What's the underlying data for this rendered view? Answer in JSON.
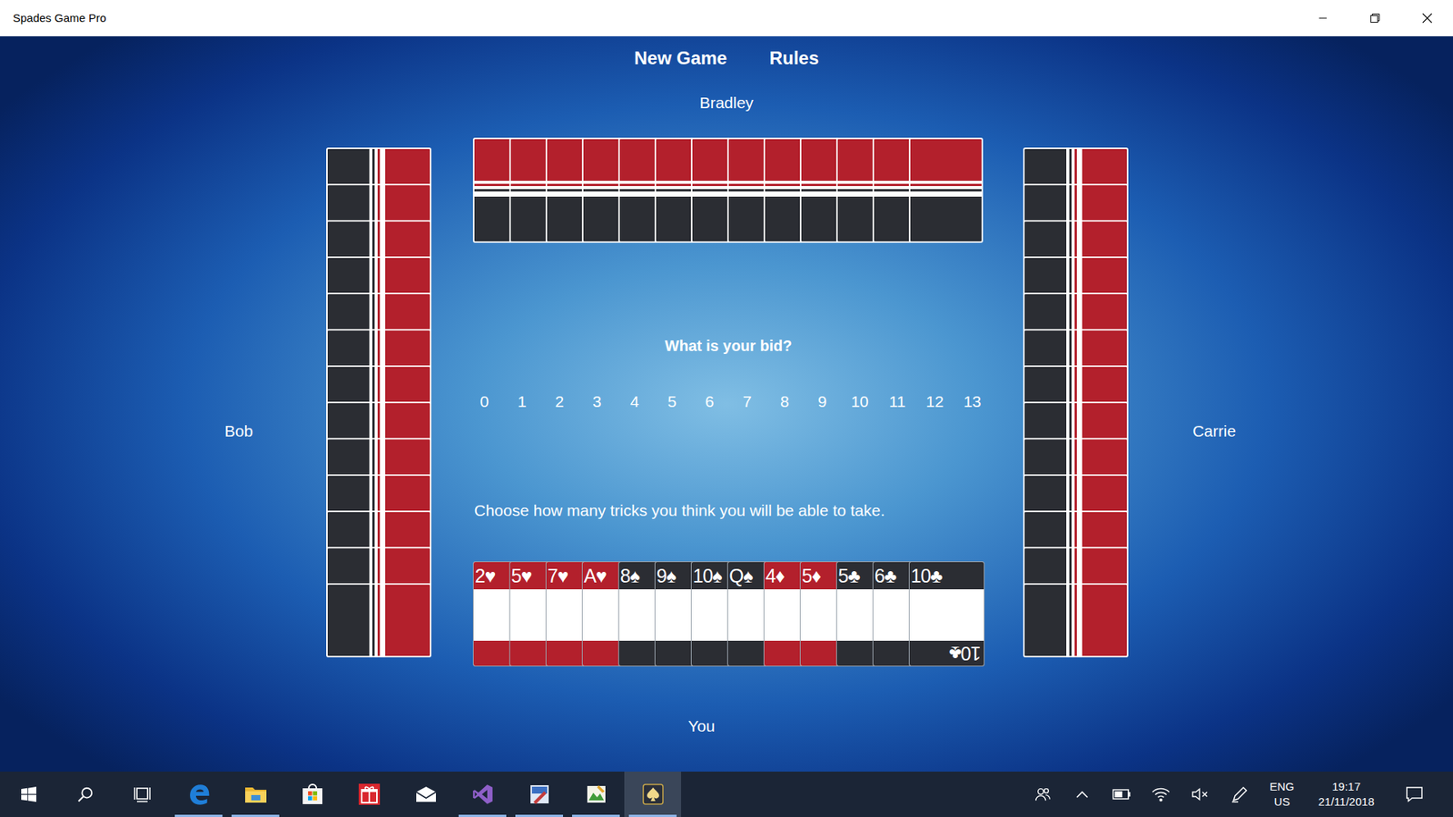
{
  "window": {
    "title": "Spades Game Pro"
  },
  "menu": [
    {
      "label": "New Game"
    },
    {
      "label": "Rules"
    }
  ],
  "bradley": {
    "name": "Bradley",
    "card_count": 13
  },
  "bob": {
    "name": "Bob",
    "card_count": 13
  },
  "carrie": {
    "name": "Carrie",
    "card_count": 13
  },
  "bid": {
    "prompt": "What is your bid?",
    "options": [
      {
        "label": "0",
        "selected": false
      },
      {
        "label": "1",
        "selected": false
      },
      {
        "label": "2",
        "selected": false
      },
      {
        "label": "3",
        "selected": false
      },
      {
        "label": "4",
        "selected": false
      },
      {
        "label": "5",
        "selected": false
      },
      {
        "label": "6",
        "selected": false
      },
      {
        "label": "7",
        "selected": false
      },
      {
        "label": "8",
        "selected": false
      },
      {
        "label": "9",
        "selected": false
      },
      {
        "label": "10",
        "selected": false
      },
      {
        "label": "11",
        "selected": false
      },
      {
        "label": "12",
        "selected": false
      },
      {
        "label": "13",
        "selected": false
      }
    ],
    "hint": "Choose how many tricks you think you will be able to take."
  },
  "you": {
    "name": "You",
    "cards": [
      {
        "label": "2♥",
        "color": "#b3202c"
      },
      {
        "label": "5♥",
        "color": "#b3202c"
      },
      {
        "label": "7♥",
        "color": "#b3202c"
      },
      {
        "label": "A♥",
        "color": "#b3202c"
      },
      {
        "label": "8♠",
        "color": "#2b2d33"
      },
      {
        "label": "9♠",
        "color": "#2b2d33"
      },
      {
        "label": "10♠",
        "color": "#2b2d33"
      },
      {
        "label": "Q♠",
        "color": "#2b2d33"
      },
      {
        "label": "4♦",
        "color": "#b3202c"
      },
      {
        "label": "5♦",
        "color": "#b3202c"
      },
      {
        "label": "5♣",
        "color": "#2b2d33"
      },
      {
        "label": "6♣",
        "color": "#2b2d33"
      },
      {
        "label": "10♣",
        "color": "#2b2d33"
      }
    ]
  },
  "taskbar": {
    "buttons": [
      {
        "kind": "start"
      },
      {
        "kind": "search"
      },
      {
        "kind": "taskview"
      }
    ],
    "apps": [
      {
        "kind": "edge",
        "running": true,
        "active": false
      },
      {
        "kind": "explorer",
        "running": true,
        "active": false
      },
      {
        "kind": "store",
        "running": false,
        "active": false
      },
      {
        "kind": "gift",
        "running": false,
        "active": false
      },
      {
        "kind": "mail",
        "running": false,
        "active": false
      },
      {
        "kind": "vs",
        "running": true,
        "active": false
      },
      {
        "kind": "editor",
        "running": true,
        "active": false
      },
      {
        "kind": "paint",
        "running": true,
        "active": false
      },
      {
        "kind": "spades",
        "running": true,
        "active": true
      }
    ],
    "tray": {
      "icons": [
        {
          "kind": "people"
        },
        {
          "kind": "chevron"
        },
        {
          "kind": "battery"
        },
        {
          "kind": "wifi"
        },
        {
          "kind": "muted"
        },
        {
          "kind": "pen"
        }
      ],
      "language": [
        "ENG",
        "US"
      ],
      "time": "19:17",
      "date": "21/11/2018"
    }
  }
}
